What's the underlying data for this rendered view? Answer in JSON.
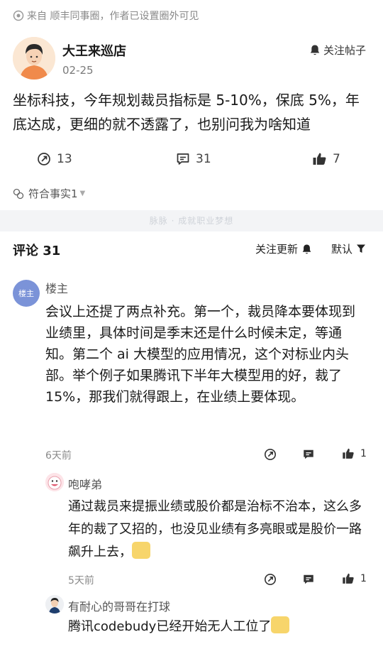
{
  "source": {
    "text": "来自 顺丰同事圈，作者已设置圈外可见",
    "icon": "circle-source-icon"
  },
  "post": {
    "author": "大王来巡店",
    "date": "02-25",
    "follow_label": "关注帖子",
    "body": "坐标科技，今年规划裁员指标是 5-10%，保底 5%，年底达成，更细的就不透露了，也别问我为啥知道",
    "shares": "13",
    "comments": "31",
    "likes": "7",
    "fact_label": "符合事实1"
  },
  "watermark": "脉脉 · 成就职业梦想",
  "comments_header": {
    "title": "评论 31",
    "follow_update": "关注更新",
    "sort": "默认"
  },
  "comments": [
    {
      "avatar_text": "楼主",
      "name": "楼主",
      "body": "会议上还提了两点补充。第一个，裁员降本要体现到业绩里，具体时间是季末还是什么时候未定，等通知。第二个 ai 大模型的应用情况，这个对标业内头部。举个例子如果腾讯下半年大模型用的好，裁了 15%，那我们就得跟上，在业绩上要体现。",
      "time": "6天前",
      "likes": "1"
    },
    {
      "name": "咆哮弟",
      "body": "通过裁员来提振业绩或股价都是治标不治本，这么多年的裁了又招的，也没见业绩有多亮眼或是股价一路飙升上去，",
      "time": "5天前",
      "likes": "1"
    },
    {
      "name": "有耐心的哥哥在打球",
      "body": "腾讯codebudy已经开始无人工位了"
    }
  ],
  "colors": {
    "accent_blue": "#7b93d8",
    "text": "#1a1a1a",
    "muted": "#8a8a8a"
  }
}
